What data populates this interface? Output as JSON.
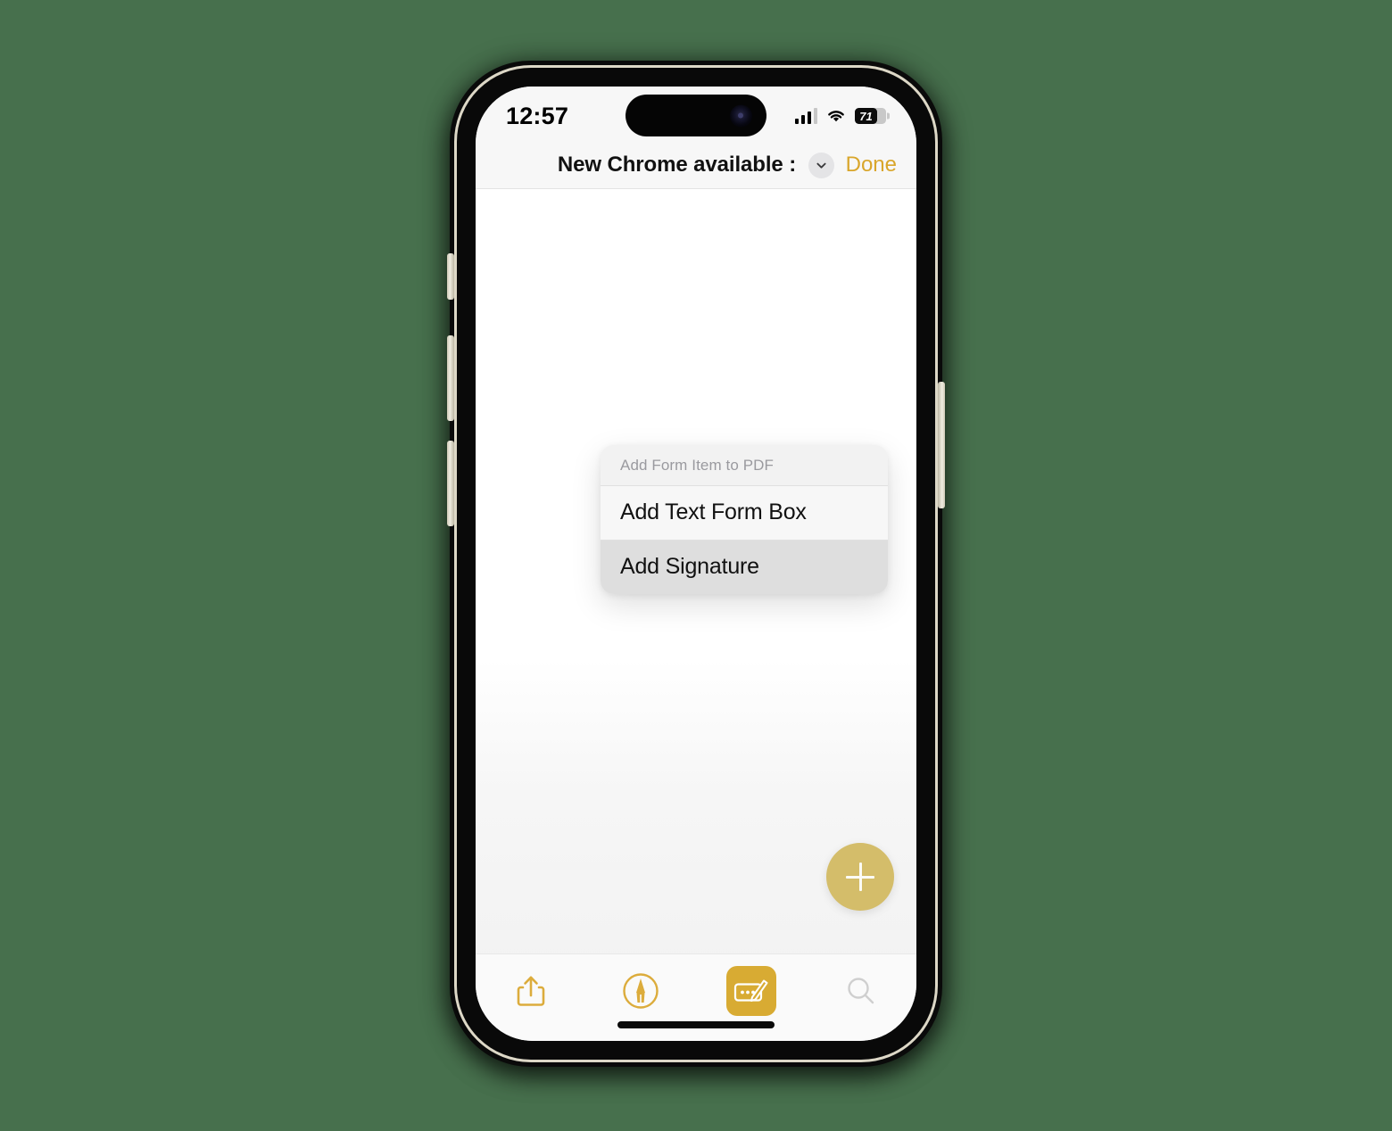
{
  "background_color": "#47704d",
  "device": {
    "name": "iphone-15-pro",
    "frame_color": "#0a0a0a",
    "rim_color": "#ddd8c7",
    "buttons": [
      "mute-switch",
      "volume-up-button",
      "volume-down-button",
      "power-button"
    ]
  },
  "status_bar": {
    "time": "12:57",
    "signal_icon": "cellular-signal-icon",
    "signal_bars_filled": 3,
    "signal_bars_total": 4,
    "wifi_icon": "wifi-icon",
    "battery_icon": "battery-icon",
    "battery_percent": "71",
    "battery_level": 71
  },
  "nav_bar": {
    "title": "New Chrome available :",
    "chevron_icon": "chevron-down-icon",
    "done_label": "Done",
    "done_color": "#d9a62b",
    "background": "#f7f7f7"
  },
  "context_menu": {
    "header": "Add Form Item to PDF",
    "items": [
      {
        "label": "Add Text Form Box",
        "highlighted": false
      },
      {
        "label": "Add Signature",
        "highlighted": true
      }
    ]
  },
  "fab": {
    "icon": "plus-icon",
    "color": "#d4bd6a",
    "label": "+"
  },
  "toolbar": {
    "background": "#fafafa",
    "accent_color": "#d8ab33",
    "items": [
      {
        "name": "share-icon",
        "active": false,
        "enabled": true
      },
      {
        "name": "markup-pen-icon",
        "active": false,
        "enabled": true
      },
      {
        "name": "form-fill-icon",
        "active": true,
        "enabled": true
      },
      {
        "name": "search-icon",
        "active": false,
        "enabled": false
      }
    ]
  },
  "home_indicator": {
    "name": "home-indicator"
  }
}
